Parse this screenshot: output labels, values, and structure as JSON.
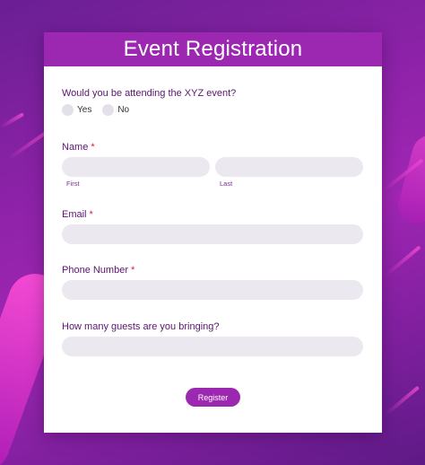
{
  "form": {
    "title": "Event Registration",
    "attending_question": "Would you be attending the XYZ event?",
    "attending_options": [
      "Yes",
      "No"
    ],
    "name_label": "Name",
    "required_mark": "*",
    "first_label": "First",
    "last_label": "Last",
    "first_value": "",
    "last_value": "",
    "email_label": "Email",
    "email_value": "",
    "phone_label": "Phone Number",
    "phone_value": "",
    "guests_label": "How many guests are you bringing?",
    "guests_value": "",
    "register_label": "Register"
  },
  "colors": {
    "accent": "#9c27b0",
    "required": "#d81b3c",
    "field_bg": "#ebe8ef",
    "label_text": "#5a1470"
  }
}
